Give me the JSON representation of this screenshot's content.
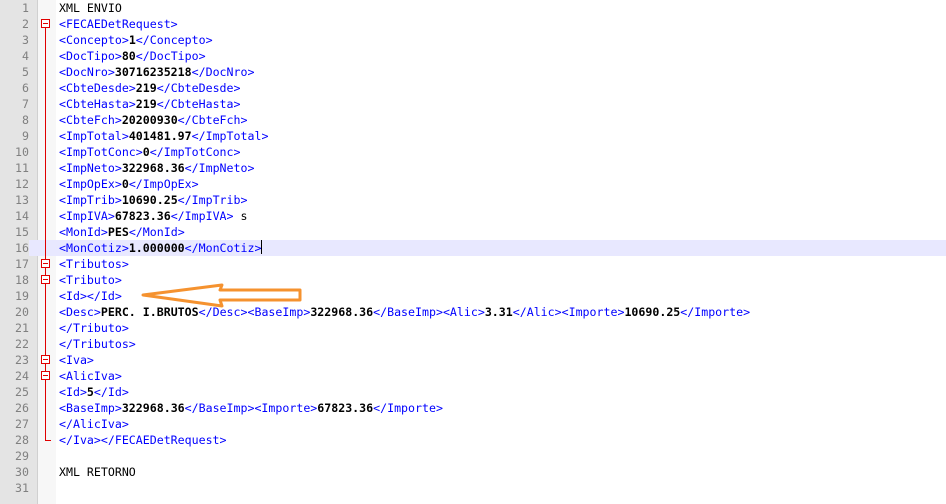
{
  "editor": {
    "lines": [
      {
        "n": "1",
        "fold": "none",
        "parts": [
          [
            "plain",
            "XML ENVIO"
          ]
        ]
      },
      {
        "n": "2",
        "fold": "open",
        "parts": [
          [
            "tag",
            "<FECAEDetRequest>"
          ]
        ]
      },
      {
        "n": "3",
        "fold": "line",
        "parts": [
          [
            "tag",
            "<Concepto>"
          ],
          [
            "txt",
            "1"
          ],
          [
            "tag",
            "</Concepto>"
          ]
        ]
      },
      {
        "n": "4",
        "fold": "line",
        "parts": [
          [
            "tag",
            "<DocTipo>"
          ],
          [
            "txt",
            "80"
          ],
          [
            "tag",
            "</DocTipo>"
          ]
        ]
      },
      {
        "n": "5",
        "fold": "line",
        "parts": [
          [
            "tag",
            "<DocNro>"
          ],
          [
            "txt",
            "30716235218"
          ],
          [
            "tag",
            "</DocNro>"
          ]
        ]
      },
      {
        "n": "6",
        "fold": "line",
        "parts": [
          [
            "tag",
            "<CbteDesde>"
          ],
          [
            "txt",
            "219"
          ],
          [
            "tag",
            "</CbteDesde>"
          ]
        ]
      },
      {
        "n": "7",
        "fold": "line",
        "parts": [
          [
            "tag",
            "<CbteHasta>"
          ],
          [
            "txt",
            "219"
          ],
          [
            "tag",
            "</CbteHasta>"
          ]
        ]
      },
      {
        "n": "8",
        "fold": "line",
        "parts": [
          [
            "tag",
            "<CbteFch>"
          ],
          [
            "txt",
            "20200930"
          ],
          [
            "tag",
            "</CbteFch>"
          ]
        ]
      },
      {
        "n": "9",
        "fold": "line",
        "parts": [
          [
            "tag",
            "<ImpTotal>"
          ],
          [
            "txt",
            "401481.97"
          ],
          [
            "tag",
            "</ImpTotal>"
          ]
        ]
      },
      {
        "n": "10",
        "fold": "line",
        "parts": [
          [
            "tag",
            "<ImpTotConc>"
          ],
          [
            "txt",
            "0"
          ],
          [
            "tag",
            "</ImpTotConc>"
          ]
        ]
      },
      {
        "n": "11",
        "fold": "line",
        "parts": [
          [
            "tag",
            "<ImpNeto>"
          ],
          [
            "txt",
            "322968.36"
          ],
          [
            "tag",
            "</ImpNeto>"
          ]
        ]
      },
      {
        "n": "12",
        "fold": "line",
        "parts": [
          [
            "tag",
            "<ImpOpEx>"
          ],
          [
            "txt",
            "0"
          ],
          [
            "tag",
            "</ImpOpEx>"
          ]
        ]
      },
      {
        "n": "13",
        "fold": "line",
        "parts": [
          [
            "tag",
            "<ImpTrib>"
          ],
          [
            "txt",
            "10690.25"
          ],
          [
            "tag",
            "</ImpTrib>"
          ]
        ]
      },
      {
        "n": "14",
        "fold": "line",
        "parts": [
          [
            "tag",
            "<ImpIVA>"
          ],
          [
            "txt",
            "67823.36"
          ],
          [
            "tag",
            "</ImpIVA>"
          ],
          [
            "plain",
            " s"
          ]
        ]
      },
      {
        "n": "15",
        "fold": "line",
        "parts": [
          [
            "tag",
            "<MonId>"
          ],
          [
            "txt",
            "PES"
          ],
          [
            "tag",
            "</MonId>"
          ]
        ]
      },
      {
        "n": "16",
        "fold": "line",
        "current": true,
        "parts": [
          [
            "tag",
            "<MonCotiz>"
          ],
          [
            "txt",
            "1.000000"
          ],
          [
            "tag",
            "</MonCotiz>"
          ],
          [
            "caret",
            ""
          ]
        ]
      },
      {
        "n": "17",
        "fold": "open",
        "parts": [
          [
            "tag",
            "<Tributos>"
          ]
        ]
      },
      {
        "n": "18",
        "fold": "open",
        "parts": [
          [
            "tag",
            "<Tributo>"
          ]
        ]
      },
      {
        "n": "19",
        "fold": "line",
        "parts": [
          [
            "tag",
            "<Id></Id>"
          ]
        ]
      },
      {
        "n": "20",
        "fold": "line",
        "parts": [
          [
            "tag",
            "<Desc>"
          ],
          [
            "txt",
            "PERC. I.BRUTOS"
          ],
          [
            "tag",
            "</Desc><BaseImp>"
          ],
          [
            "txt",
            "322968.36"
          ],
          [
            "tag",
            "</BaseImp><Alic>"
          ],
          [
            "txt",
            "3.31"
          ],
          [
            "tag",
            "</Alic><Importe>"
          ],
          [
            "txt",
            "10690.25"
          ],
          [
            "tag",
            "</Importe>"
          ]
        ]
      },
      {
        "n": "21",
        "fold": "line",
        "parts": [
          [
            "tag",
            "</Tributo>"
          ]
        ]
      },
      {
        "n": "22",
        "fold": "line",
        "parts": [
          [
            "tag",
            "</Tributos>"
          ]
        ]
      },
      {
        "n": "23",
        "fold": "open",
        "parts": [
          [
            "tag",
            "<Iva>"
          ]
        ]
      },
      {
        "n": "24",
        "fold": "open",
        "parts": [
          [
            "tag",
            "<AlicIva>"
          ]
        ]
      },
      {
        "n": "25",
        "fold": "line",
        "parts": [
          [
            "tag",
            "<Id>"
          ],
          [
            "txt",
            "5"
          ],
          [
            "tag",
            "</Id>"
          ]
        ]
      },
      {
        "n": "26",
        "fold": "line",
        "parts": [
          [
            "tag",
            "<BaseImp>"
          ],
          [
            "txt",
            "322968.36"
          ],
          [
            "tag",
            "</BaseImp><Importe>"
          ],
          [
            "txt",
            "67823.36"
          ],
          [
            "tag",
            "</Importe>"
          ]
        ]
      },
      {
        "n": "27",
        "fold": "line",
        "parts": [
          [
            "tag",
            "</AlicIva>"
          ]
        ]
      },
      {
        "n": "28",
        "fold": "end",
        "parts": [
          [
            "tag",
            "</Iva></FECAEDetRequest>"
          ]
        ]
      },
      {
        "n": "29",
        "fold": "none",
        "parts": []
      },
      {
        "n": "30",
        "fold": "none",
        "parts": [
          [
            "plain",
            "XML RETORNO"
          ]
        ]
      },
      {
        "n": "31",
        "fold": "none",
        "parts": []
      }
    ]
  },
  "annotation": {
    "arrow_color": "#f5922f",
    "points_to_line": "19"
  },
  "colors": {
    "tag": "#0000ff",
    "text": "#000000",
    "fold_marker": "#e00000",
    "current_line": "#e8e8ff"
  }
}
